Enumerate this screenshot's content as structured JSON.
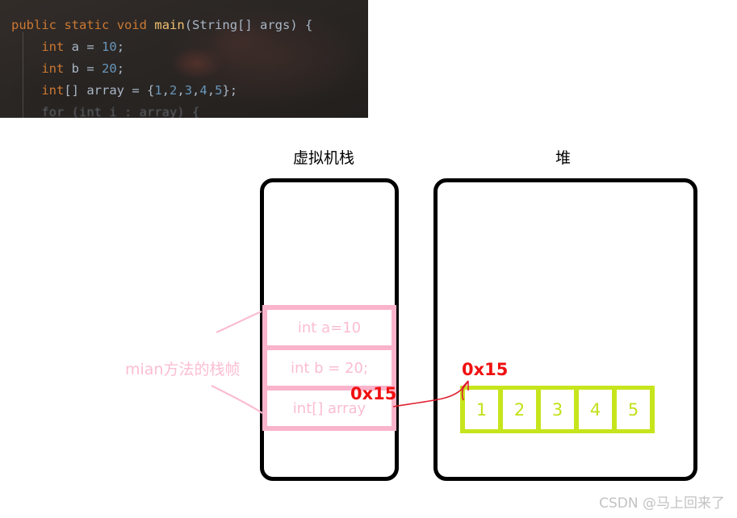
{
  "code_snippet": {
    "lines": [
      {
        "id": "line-1",
        "tokens": [
          {
            "t": "public",
            "c": "tk-key"
          },
          {
            "t": " ",
            "c": "tk-pun"
          },
          {
            "t": "static",
            "c": "tk-key"
          },
          {
            "t": " ",
            "c": "tk-pun"
          },
          {
            "t": "void",
            "c": "tk-key"
          },
          {
            "t": " ",
            "c": "tk-pun"
          },
          {
            "t": "main",
            "c": "tk-fn"
          },
          {
            "t": "(",
            "c": "tk-pun"
          },
          {
            "t": "String[] args",
            "c": "tk-txt"
          },
          {
            "t": ") {",
            "c": "tk-pun"
          }
        ],
        "plain": "public static void main(String[] args) {"
      },
      {
        "id": "line-2",
        "tokens": [
          {
            "t": "    ",
            "c": "tk-pun"
          },
          {
            "t": "int",
            "c": "tk-key"
          },
          {
            "t": " ",
            "c": "tk-pun"
          },
          {
            "t": "a",
            "c": "tk-txt"
          },
          {
            "t": " = ",
            "c": "tk-pun"
          },
          {
            "t": "10",
            "c": "tk-num"
          },
          {
            "t": ";",
            "c": "tk-pun"
          }
        ],
        "plain": "    int a = 10;"
      },
      {
        "id": "line-3",
        "tokens": [
          {
            "t": "    ",
            "c": "tk-pun"
          },
          {
            "t": "int",
            "c": "tk-key"
          },
          {
            "t": " ",
            "c": "tk-pun"
          },
          {
            "t": "b",
            "c": "tk-txt"
          },
          {
            "t": " = ",
            "c": "tk-pun"
          },
          {
            "t": "20",
            "c": "tk-num"
          },
          {
            "t": ";",
            "c": "tk-pun"
          }
        ],
        "plain": "    int b = 20;"
      },
      {
        "id": "line-4",
        "tokens": [
          {
            "t": "    ",
            "c": "tk-pun"
          },
          {
            "t": "int",
            "c": "tk-key"
          },
          {
            "t": "[] ",
            "c": "tk-pun"
          },
          {
            "t": "array",
            "c": "tk-txt"
          },
          {
            "t": " = {",
            "c": "tk-pun"
          },
          {
            "t": "1",
            "c": "tk-num"
          },
          {
            "t": ",",
            "c": "tk-pun"
          },
          {
            "t": "2",
            "c": "tk-num"
          },
          {
            "t": ",",
            "c": "tk-pun"
          },
          {
            "t": "3",
            "c": "tk-num"
          },
          {
            "t": ",",
            "c": "tk-pun"
          },
          {
            "t": "4",
            "c": "tk-num"
          },
          {
            "t": ",",
            "c": "tk-pun"
          },
          {
            "t": "5",
            "c": "tk-num"
          },
          {
            "t": "};",
            "c": "tk-pun"
          }
        ],
        "plain": "    int[] array = {1,2,3,4,5};"
      },
      {
        "id": "line-5-clipped",
        "tokens": [
          {
            "t": "    for (int i : array) {",
            "c": "tk-txt"
          }
        ],
        "plain": "    for (int i : array) {"
      }
    ]
  },
  "diagram": {
    "stack": {
      "title": "虚拟机栈",
      "frame_label": "mian方法的栈帧",
      "rows": [
        {
          "id": "row-a",
          "text": "int a=10"
        },
        {
          "id": "row-b",
          "text": "int b = 20;"
        },
        {
          "id": "row-array",
          "text": "int[] array"
        }
      ],
      "reference_address": "0x15"
    },
    "heap": {
      "title": "堆",
      "object_address": "0x15",
      "array_values": [
        "1",
        "2",
        "3",
        "4",
        "5"
      ]
    }
  },
  "watermark": {
    "text": "CSDN @马上回来了"
  },
  "colors": {
    "frame_pink": "#f9b4cb",
    "frame_text_pink": "#fbbdd2",
    "array_green": "#c7e51c",
    "annotation_red": "#f01010",
    "box_black": "#000000",
    "code_bg": "#2b2725"
  }
}
